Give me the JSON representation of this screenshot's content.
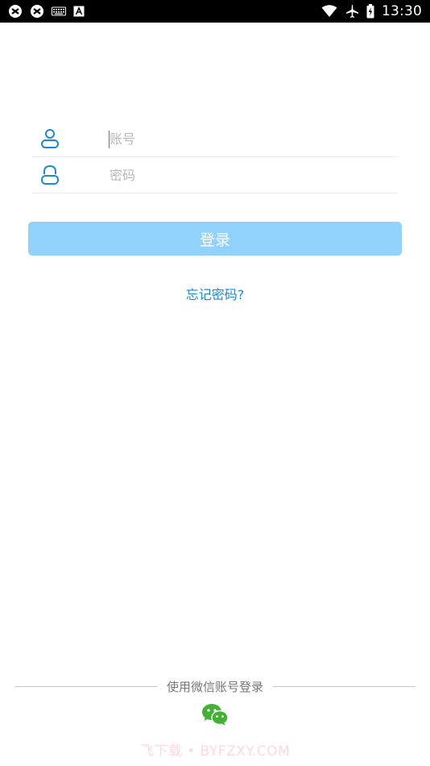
{
  "status_bar": {
    "time": "13:30",
    "left_icons": [
      "app-icon",
      "app-icon",
      "keyboard-icon",
      "text-a-icon"
    ],
    "right_icons": [
      "wifi-icon",
      "airplane-icon",
      "battery-icon"
    ]
  },
  "form": {
    "account_placeholder": "账号",
    "password_placeholder": "密码"
  },
  "login_label": "登录",
  "forgot_label": "忘记密码?",
  "third_party": {
    "divider_text": "使用微信账号登录"
  },
  "watermark": "飞下载 • BYFZXY.COM",
  "colors": {
    "accent": "#1a8ad8",
    "button": "#90d2fc",
    "wechat": "#44b035"
  }
}
